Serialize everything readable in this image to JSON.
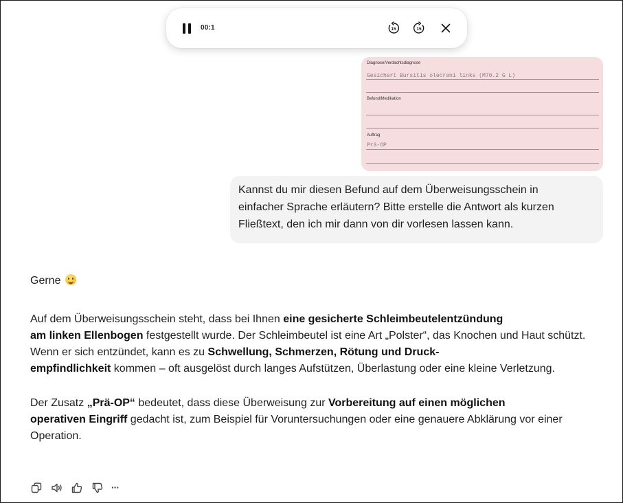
{
  "audio_player": {
    "time": "00:1",
    "skip_back_label": "15",
    "skip_forward_label": "15",
    "icons": [
      "pause-icon",
      "skip-back-15-icon",
      "skip-forward-15-icon",
      "close-icon"
    ]
  },
  "referral_card": {
    "diagnosis_label": "Diagnose/Verdachtsdiagnose",
    "diagnosis_value": "Gesichert Bursitis olecrani links (M70.2 G L)",
    "findings_label": "Befund/Medikation",
    "order_label": "Auftrag",
    "order_value": "Prä-OP",
    "background_color": "#f6dde0"
  },
  "user_message": {
    "line1": "Kannst du mir diesen Befund auf dem Überweisungsschein in",
    "line2": "einfacher Sprache erläutern? Bitte erstelle die Antwort als kurzen",
    "line3": "Fließtext, den ich mir dann von dir vorlesen lassen kann."
  },
  "assistant_reply": {
    "greeting": "Gerne",
    "p1": {
      "t1": "Auf dem Überweisungsschein steht, dass bei Ihnen ",
      "b1": "eine gesicherte Schleimbeutelentzündung",
      "b2": "am linken Ellenbogen",
      "t2": " festgestellt wurde. Der Schleimbeutel ist eine Art „Polster“, das Knochen und Haut schützt. Wenn er sich entzündet, kann es zu ",
      "b3": "Schwellung, Schmerzen, Rötung und Druck-",
      "b4": "empfindlichkeit",
      "t3": " kommen – oft ausgelöst durch langes Aufstützen, Überlastung oder eine kleine Verletzung."
    },
    "p2": {
      "t1": "Der Zusatz ",
      "b1": "„Prä-OP“",
      "t2": " bedeutet, dass diese Überweisung zur ",
      "b2": "Vorbereitung auf einen möglichen",
      "b3": "operativen Eingriff",
      "t3": " gedacht ist, zum Beispiel für Voruntersuchungen oder eine genauere Abklärung vor einer Operation."
    }
  },
  "action_bar": {
    "icons": [
      "copy-icon",
      "read-aloud-icon",
      "thumbs-up-icon",
      "thumbs-down-icon",
      "more-icon"
    ],
    "more_label": "···"
  }
}
